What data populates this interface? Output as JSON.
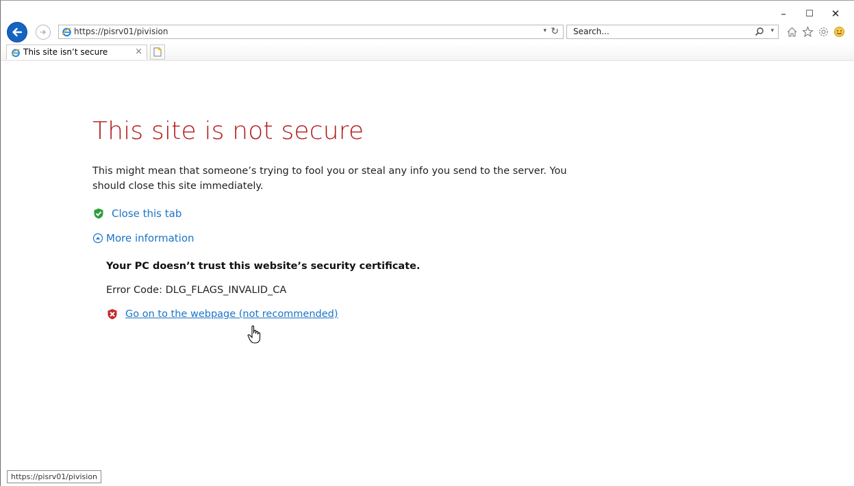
{
  "window": {
    "minimize": "–",
    "maximize": "☐",
    "close": "✕"
  },
  "navbar": {
    "url": "https://pisrv01/pivision",
    "search_placeholder": "Search..."
  },
  "tab": {
    "label": "This site isn’t secure",
    "close": "×"
  },
  "page": {
    "title": "This site is not secure",
    "description": "This might mean that someone’s trying to fool you or steal any info you send to the server. You should close this site immediately.",
    "close_tab": "Close this tab",
    "more_info": "More information",
    "cert_headline": "Your PC doesn’t trust this website’s security certificate.",
    "error_code": "Error Code: DLG_FLAGS_INVALID_CA",
    "go_on": "Go on to the webpage (not recommended)"
  },
  "statusbar": {
    "text": "https://pisrv01/pivision"
  },
  "colors": {
    "title_red": "#b2191b",
    "link_blue": "#1a73c8",
    "back_button_blue": "#1565c0"
  }
}
